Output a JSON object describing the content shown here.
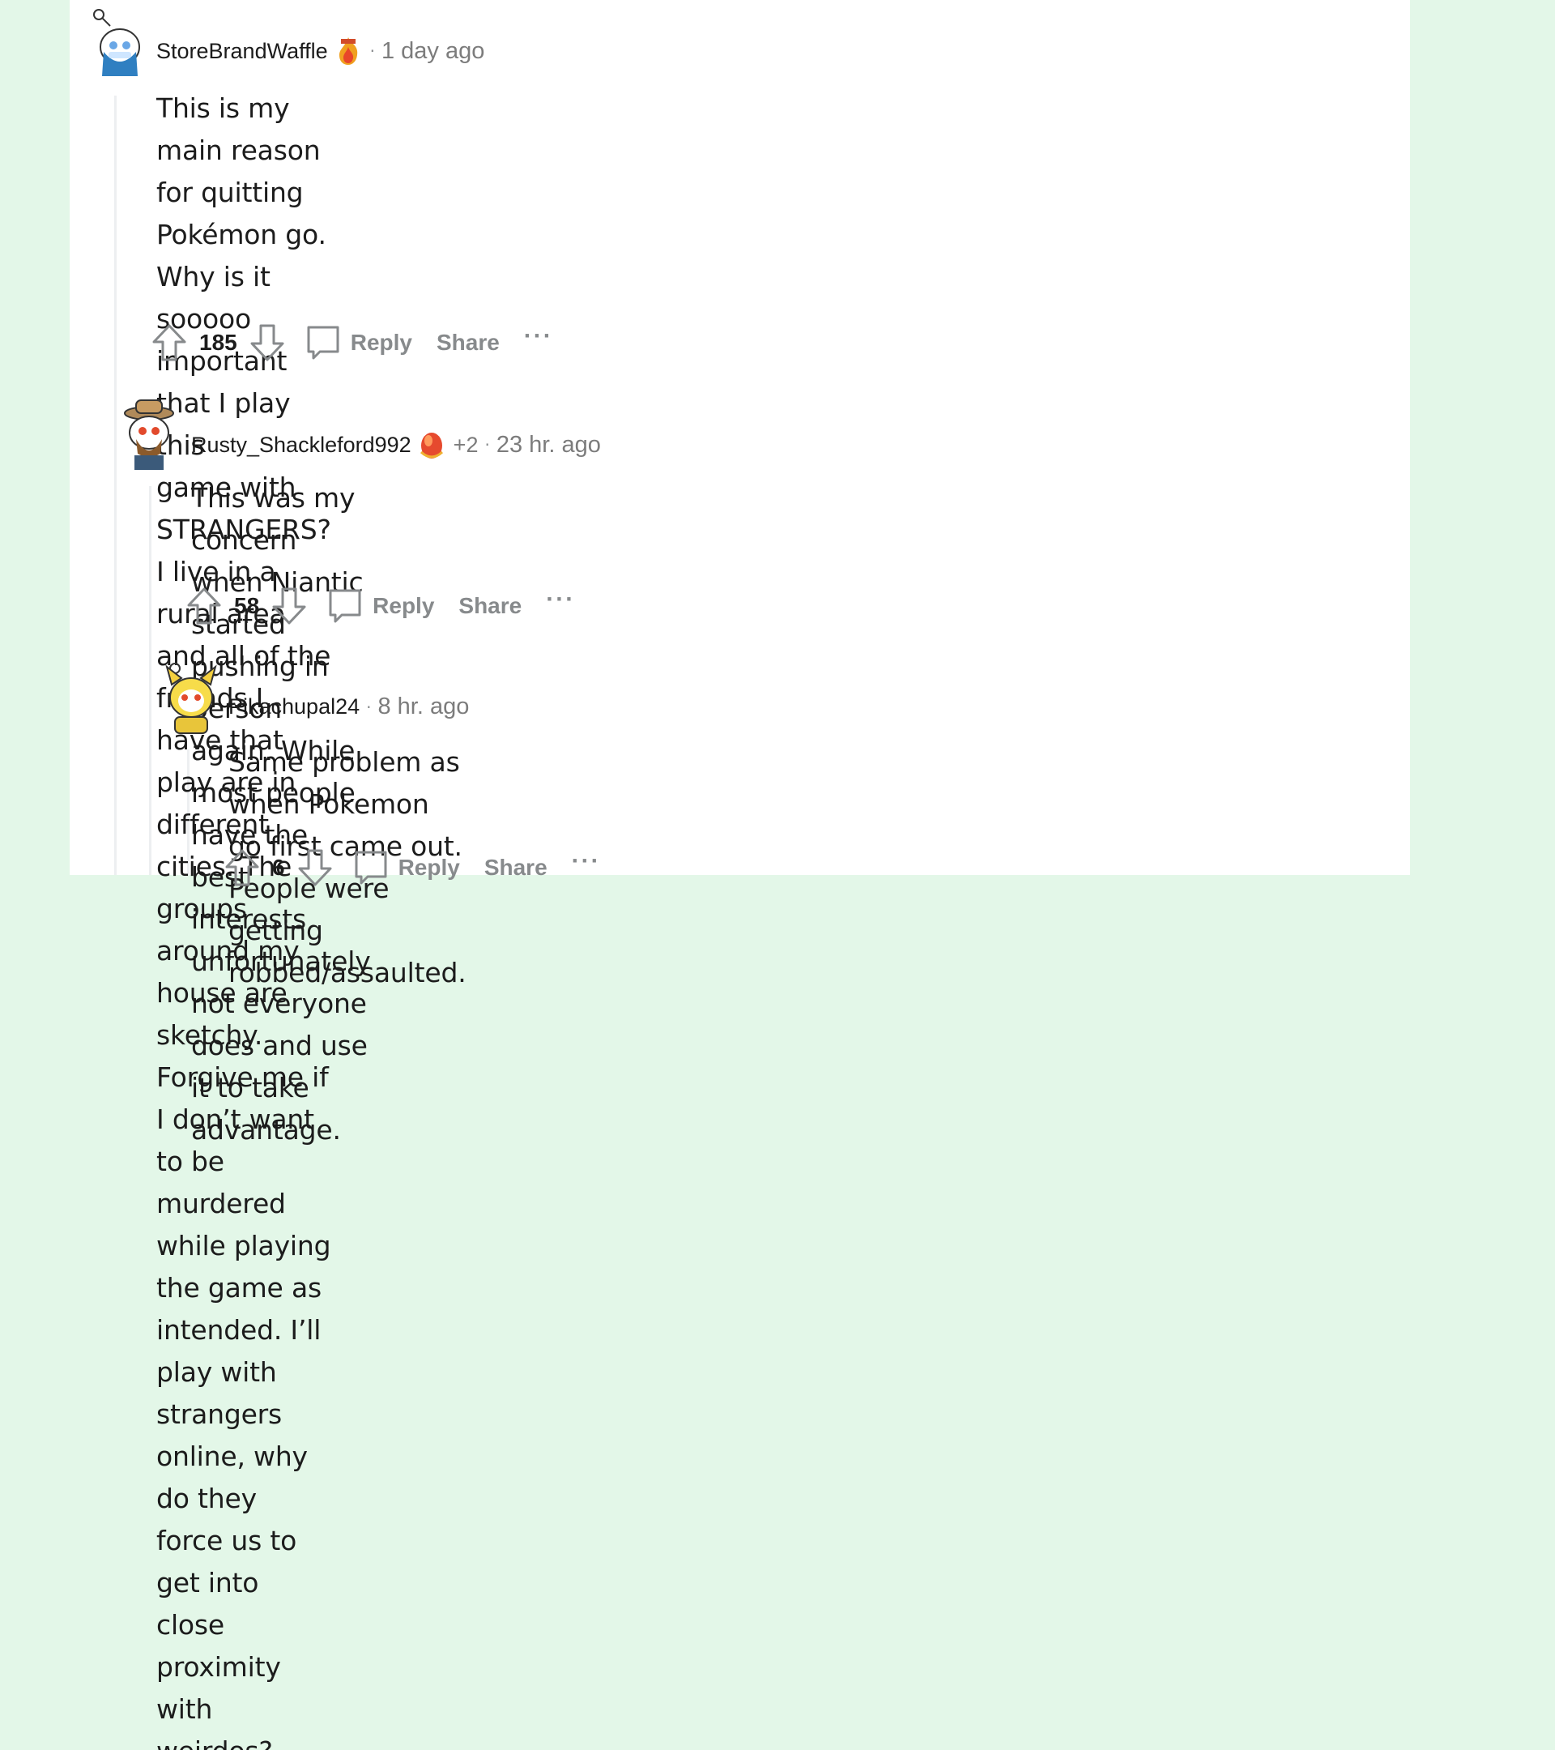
{
  "comments": [
    {
      "author": "StoreBrandWaffle",
      "time": "1 day ago",
      "extra": "",
      "body": [
        "This is my main reason for quitting Pokémon go. Why is it sooooo important that I play this",
        "game with STRANGERS? I live in a rural area and all of the friends I have that play are in",
        "different cities. The groups around my house are sketchy. Forgive me if I don’t want to be",
        "murdered while playing the game as intended. I’ll play with strangers online, why do they",
        "force us to get into close proximity with weirdos?"
      ],
      "score": "185",
      "reply_label": "Reply",
      "share_label": "Share",
      "more_label": "···",
      "avatar_icon": "snoo-avatar-icon",
      "flair_icon": "flame-flair-icon"
    },
    {
      "author": "Rusty_Shackleford992",
      "time": "23 hr. ago",
      "extra": "+2",
      "body": [
        "This was my concern when Niantic started pushing in person again. While most people",
        "have the best interests unfortunately not everyone does and use it to take advantage."
      ],
      "score": "58",
      "reply_label": "Reply",
      "share_label": "Share",
      "more_label": "···",
      "avatar_icon": "cowboy-snoo-avatar-icon",
      "flair_icon": "gem-flair-icon"
    },
    {
      "author": "Pikachupal24",
      "time": "8 hr. ago",
      "extra": "",
      "body": [
        "Same problem as when Pokemon go first came out. People were getting",
        "robbed/assaulted."
      ],
      "score": "6",
      "reply_label": "Reply",
      "share_label": "Share",
      "more_label": "···",
      "avatar_icon": "pikachu-snoo-avatar-icon"
    }
  ],
  "colors": {
    "background": "#e3f7e8",
    "panel": "#ffffff",
    "text": "#1c1c1c",
    "muted": "#878a8c",
    "thread_line": "#edeff1"
  }
}
